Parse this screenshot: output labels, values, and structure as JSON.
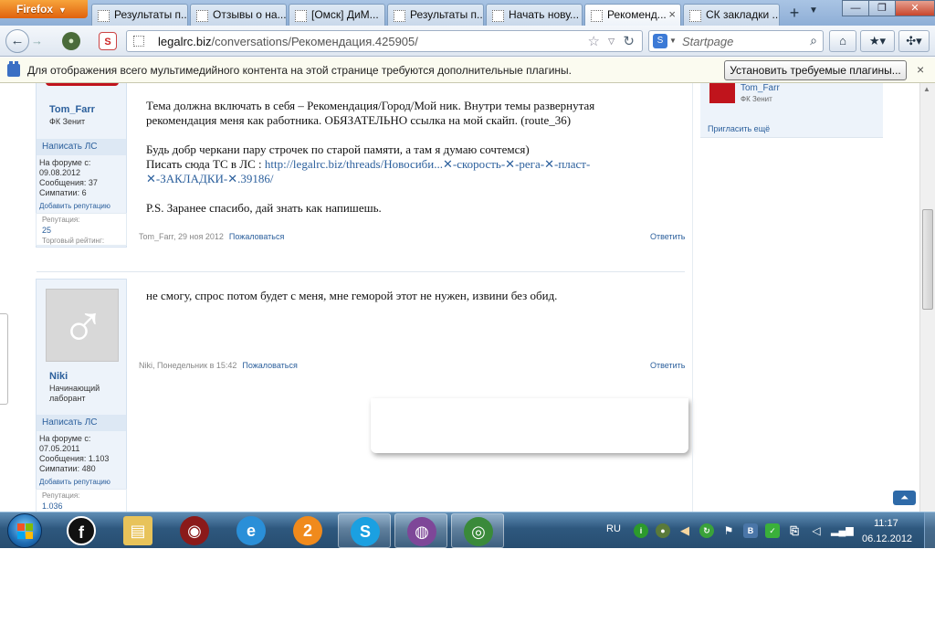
{
  "browser": {
    "menu_label": "Firefox",
    "tabs": [
      {
        "label": "Результаты п..."
      },
      {
        "label": "Отзывы о на..."
      },
      {
        "label": "[Омск] ДиМ..."
      },
      {
        "label": "Результаты п..."
      },
      {
        "label": "Начать нову..."
      },
      {
        "label": "Рекоменд...",
        "active": true
      },
      {
        "label": "СК закладки ..."
      }
    ],
    "new_tab": "+",
    "url_domain": "legalrc.biz",
    "url_path": "/conversations/Рекомендация.425905/",
    "search_placeholder": "Startpage"
  },
  "plugin_bar": {
    "message": "Для отображения всего мультимедийного контента на этой странице требуются дополнительные плагины.",
    "button": "Установить требуемые плагины...",
    "close": "×"
  },
  "posts": [
    {
      "user": {
        "name": "Tom_Farr",
        "title": "ФК Зенит",
        "pm": "Написать ЛС",
        "since_label": "На форуме с:",
        "since": "09.08.2012",
        "messages_label": "Сообщения:",
        "messages": "37",
        "likes_label": "Симпатии:",
        "likes": "6",
        "add_rep": "Добавить репутацию",
        "rep_label": "Репутация:",
        "rep": "25",
        "trade": "Торговый рейтинг:"
      },
      "lines": [
        "Тема должна включать в себя – Рекомендация/Город/Мой ник. Внутри темы развернутая",
        "рекомендация меня как работника. ОБЯЗАТЕЛЬНО ссылка на мой скайп. (route_36)",
        "",
        "Будь добр черкани пару строчек по старой памяти, а там я думаю сочтемся)",
        "Писать сюда ТС в ЛС :"
      ],
      "link_line1": "http://legalrc.biz/threads/Новосиби...✕-скорость-✕-рега-✕-пласт-",
      "link_line2": "✕-ЗАКЛАДКИ-✕.39186/",
      "ps": "P.S. Заранее спасибо, дай знать как напишешь.",
      "meta_author": "Tom_Farr",
      "meta_date": "29 ноя 2012",
      "report": "Пожаловаться",
      "reply": "Ответить"
    },
    {
      "user": {
        "name": "Niki",
        "title_line1": "Начинающий",
        "title_line2": "лаборант",
        "pm": "Написать ЛС",
        "since_label": "На форуме с:",
        "since": "07.05.2011",
        "messages_label": "Сообщения:",
        "messages": "1.103",
        "likes_label": "Симпатии:",
        "likes": "480",
        "add_rep": "Добавить репутацию",
        "rep_label": "Репутация:",
        "rep": "1.036"
      },
      "text": "не смогу, спрос потом будет с меня, мне геморой этот не нужен, извини без обид.",
      "meta_author": "Niki",
      "meta_date": "Понедельник в 15:42",
      "report": "Пожаловаться",
      "reply": "Ответить"
    }
  ],
  "sidebar": {
    "name": "Tom_Farr",
    "club": "ФК Зенит",
    "invite": "Пригласить ещё"
  },
  "taskbar": {
    "language": "RU",
    "time": "11:17",
    "date": "06.12.2012"
  }
}
